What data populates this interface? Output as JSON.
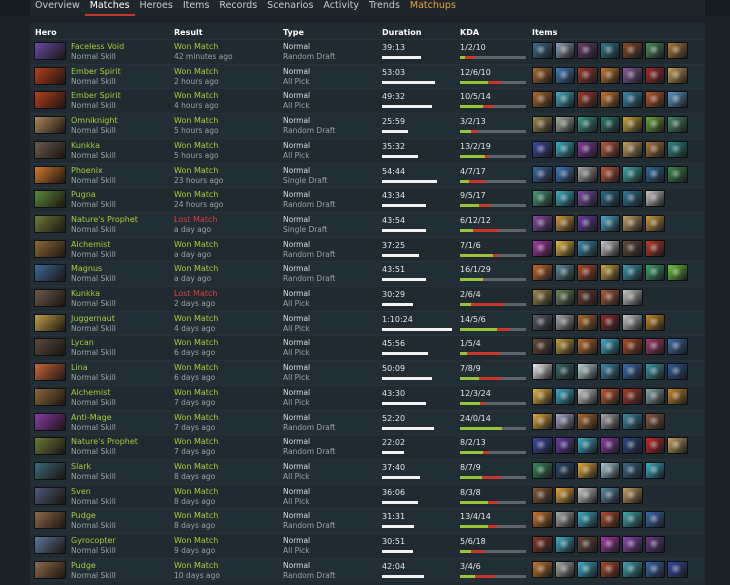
{
  "nav": {
    "tabs": [
      {
        "label": "Overview",
        "state": "normal"
      },
      {
        "label": "Matches",
        "state": "active"
      },
      {
        "label": "Heroes",
        "state": "normal"
      },
      {
        "label": "Items",
        "state": "normal"
      },
      {
        "label": "Records",
        "state": "normal"
      },
      {
        "label": "Scenarios",
        "state": "normal"
      },
      {
        "label": "Activity",
        "state": "normal"
      },
      {
        "label": "Trends",
        "state": "normal"
      },
      {
        "label": "Matchups",
        "state": "highlight"
      }
    ]
  },
  "table": {
    "headers": {
      "hero": "Hero",
      "result": "Result",
      "type": "Type",
      "duration": "Duration",
      "kda": "KDA",
      "items": "Items"
    },
    "rows": [
      {
        "hero": "Faceless Void",
        "skill": "Normal Skill",
        "result": "Won Match",
        "outcome": "win",
        "time": "42 minutes ago",
        "type": "Normal",
        "mode": "Random Draft",
        "duration": "39:13",
        "duration_min": 39.2,
        "kda": "1/2/10",
        "k": 1,
        "d": 2,
        "a": 10,
        "portrait": "#6a4aa8",
        "items": [
          "#3c6e8a",
          "#8fa6b8",
          "#6c3a70",
          "#2f7c8c",
          "#8a4a26",
          "#4a8f5a",
          "#b07a38"
        ]
      },
      {
        "hero": "Ember Spirit",
        "skill": "Normal Skill",
        "result": "Won Match",
        "outcome": "win",
        "time": "2 hours ago",
        "type": "Normal",
        "mode": "All Pick",
        "duration": "53:03",
        "duration_min": 53.1,
        "kda": "12/6/10",
        "k": 12,
        "d": 6,
        "a": 10,
        "portrait": "#b5401e",
        "items": [
          "#b06a2a",
          "#3f7fc0",
          "#a03a28",
          "#c8782a",
          "#8a5a9a",
          "#a82a2a",
          "#c8a050"
        ]
      },
      {
        "hero": "Ember Spirit",
        "skill": "Normal Skill",
        "result": "Won Match",
        "outcome": "win",
        "time": "4 hours ago",
        "type": "Normal",
        "mode": "All Pick",
        "duration": "49:32",
        "duration_min": 49.5,
        "kda": "10/5/14",
        "k": 10,
        "d": 5,
        "a": 14,
        "portrait": "#b5401e",
        "items": [
          "#b06a2a",
          "#3fb0c8",
          "#a03a28",
          "#c8782a",
          "#3a8ab0",
          "#c05a2a",
          "#5a9ac8"
        ]
      },
      {
        "hero": "Omniknight",
        "skill": "Normal Skill",
        "result": "Won Match",
        "outcome": "win",
        "time": "5 hours ago",
        "type": "Normal",
        "mode": "Random Draft",
        "duration": "25:59",
        "duration_min": 26.0,
        "kda": "3/2/13",
        "k": 3,
        "d": 2,
        "a": 13,
        "portrait": "#a88858",
        "items": [
          "#a08a4a",
          "#a8b0a0",
          "#3a9a8a",
          "#2a7a6a",
          "#c8a83a",
          "#6aa83a",
          "#4a8a6a"
        ]
      },
      {
        "hero": "Kunkka",
        "skill": "Normal Skill",
        "result": "Won Match",
        "outcome": "win",
        "time": "5 hours ago",
        "type": "Normal",
        "mode": "All Pick",
        "duration": "35:32",
        "duration_min": 35.5,
        "kda": "13/2/19",
        "k": 13,
        "d": 2,
        "a": 19,
        "portrait": "#6a5a4a",
        "items": [
          "#3a4aa8",
          "#3ab0c8",
          "#8a3aa8",
          "#c05a3a",
          "#c8a060",
          "#b07a38",
          "#2a8a8a"
        ]
      },
      {
        "hero": "Phoenix",
        "skill": "Normal Skill",
        "result": "Won Match",
        "outcome": "win",
        "time": "23 hours ago",
        "type": "Normal",
        "mode": "Single Draft",
        "duration": "54:44",
        "duration_min": 54.7,
        "kda": "4/7/17",
        "k": 4,
        "d": 7,
        "a": 17,
        "portrait": "#d07a2a",
        "items": [
          "#3a6aa8",
          "#3a7ac0",
          "#a8a8a8",
          "#c05a3a",
          "#3aa8a8",
          "#2a6a9a",
          "#3a8a4a"
        ]
      },
      {
        "hero": "Pugna",
        "skill": "Normal Skill",
        "result": "Won Match",
        "outcome": "win",
        "time": "24 hours ago",
        "type": "Normal",
        "mode": "Random Draft",
        "duration": "43:34",
        "duration_min": 43.6,
        "kda": "9/5/17",
        "k": 9,
        "d": 5,
        "a": 17,
        "portrait": "#5a8a3a",
        "items": [
          "#4a9a7a",
          "#3ab0c8",
          "#7a4aa8",
          "#2a6a8a",
          "#2a7a9a",
          "#c8c8c8"
        ]
      },
      {
        "hero": "Nature's Prophet",
        "skill": "Normal Skill",
        "result": "Lost Match",
        "outcome": "loss",
        "time": "a day ago",
        "type": "Normal",
        "mode": "Single Draft",
        "duration": "43:54",
        "duration_min": 43.9,
        "kda": "6/12/12",
        "k": 6,
        "d": 12,
        "a": 12,
        "portrait": "#6a7a3a",
        "items": [
          "#8a4aa8",
          "#d09a3a",
          "#6a3aa8",
          "#4aa8c8",
          "#c8a060",
          "#c89a3a"
        ]
      },
      {
        "hero": "Alchemist",
        "skill": "Normal Skill",
        "result": "Won Match",
        "outcome": "win",
        "time": "a day ago",
        "type": "Normal",
        "mode": "Random Draft",
        "duration": "37:25",
        "duration_min": 37.4,
        "kda": "7/1/6",
        "k": 7,
        "d": 1,
        "a": 6,
        "portrait": "#8a6a3a",
        "items": [
          "#a83aa8",
          "#e8b83a",
          "#3a8ab0",
          "#c8c8c8",
          "#6a4a3a",
          "#c03a2a"
        ]
      },
      {
        "hero": "Magnus",
        "skill": "Normal Skill",
        "result": "Won Match",
        "outcome": "win",
        "time": "a day ago",
        "type": "Normal",
        "mode": "Random Draft",
        "duration": "43:51",
        "duration_min": 43.9,
        "kda": "16/1/29",
        "k": 16,
        "d": 1,
        "a": 29,
        "portrait": "#3a6a9a",
        "items": [
          "#c86a2a",
          "#5a8a9a",
          "#b04a2a",
          "#c8a83a",
          "#3a9ab0",
          "#3aa86a",
          "#6ac83a"
        ]
      },
      {
        "hero": "Kunkka",
        "skill": "Normal Skill",
        "result": "Lost Match",
        "outcome": "loss",
        "time": "2 days ago",
        "type": "Normal",
        "mode": "All Pick",
        "duration": "30:29",
        "duration_min": 30.5,
        "kda": "2/6/4",
        "k": 2,
        "d": 6,
        "a": 4,
        "portrait": "#6a5a4a",
        "items": [
          "#a08a4a",
          "#6a8a5a",
          "#6a3a2a",
          "#b05a3a",
          "#c8c8c8"
        ]
      },
      {
        "hero": "Juggernaut",
        "skill": "Normal Skill",
        "result": "Won Match",
        "outcome": "win",
        "time": "4 days ago",
        "type": "Normal",
        "mode": "All Pick",
        "duration": "1:10:24",
        "duration_min": 70.4,
        "kda": "14/5/6",
        "k": 14,
        "d": 5,
        "a": 6,
        "portrait": "#c0a04a",
        "items": [
          "#5a5a6a",
          "#a8a8a8",
          "#b06a2a",
          "#8a2a2a",
          "#c8c8c8",
          "#c8882a"
        ]
      },
      {
        "hero": "Lycan",
        "skill": "Normal Skill",
        "result": "Won Match",
        "outcome": "win",
        "time": "6 days ago",
        "type": "Normal",
        "mode": "All Pick",
        "duration": "45:56",
        "duration_min": 45.9,
        "kda": "1/5/4",
        "k": 1,
        "d": 5,
        "a": 4,
        "portrait": "#5a4a3a",
        "items": [
          "#6a4a3a",
          "#c8a03a",
          "#c06a2a",
          "#3ab0c8",
          "#b04a2a",
          "#a83a6a",
          "#3a6ab0"
        ]
      },
      {
        "hero": "Lina",
        "skill": "Normal Skill",
        "result": "Won Match",
        "outcome": "win",
        "time": "6 days ago",
        "type": "Normal",
        "mode": "All Pick",
        "duration": "50:09",
        "duration_min": 50.2,
        "kda": "7/8/9",
        "k": 7,
        "d": 8,
        "a": 9,
        "portrait": "#c86a3a",
        "items": [
          "#f0f0f0",
          "#3a6a6a",
          "#b8d8d8",
          "#3a8ab0",
          "#3a6ab0",
          "#3a9aa8",
          "#2a5a9a"
        ]
      },
      {
        "hero": "Alchemist",
        "skill": "Normal Skill",
        "result": "Won Match",
        "outcome": "win",
        "time": "7 days ago",
        "type": "Normal",
        "mode": "All Pick",
        "duration": "43:30",
        "duration_min": 43.5,
        "kda": "12/3/24",
        "k": 12,
        "d": 3,
        "a": 24,
        "portrait": "#8a6a3a",
        "items": [
          "#e8b83a",
          "#3ab0c8",
          "#c8c8c8",
          "#c05a2a",
          "#a83a2a",
          "#8aa8a8",
          "#c8882a"
        ]
      },
      {
        "hero": "Anti-Mage",
        "skill": "Normal Skill",
        "result": "Won Match",
        "outcome": "win",
        "time": "7 days ago",
        "type": "Normal",
        "mode": "Random Draft",
        "duration": "52:20",
        "duration_min": 52.3,
        "kda": "24/0/14",
        "k": 24,
        "d": 0,
        "a": 14,
        "portrait": "#8a3aa8",
        "items": [
          "#e8a83a",
          "#a8a8c8",
          "#b06a2a",
          "#a8a8a8",
          "#3a8aa8",
          "#8a5a3a"
        ]
      },
      {
        "hero": "Nature's Prophet",
        "skill": "Normal Skill",
        "result": "Won Match",
        "outcome": "win",
        "time": "7 days ago",
        "type": "Normal",
        "mode": "Random Draft",
        "duration": "22:02",
        "duration_min": 22.0,
        "kda": "8/2/13",
        "k": 8,
        "d": 2,
        "a": 13,
        "portrait": "#6a7a3a",
        "items": [
          "#3a4aa8",
          "#6a3aa8",
          "#3ab0c8",
          "#8a3aa8",
          "#2a4a8a",
          "#c82a2a",
          "#c8a060"
        ]
      },
      {
        "hero": "Slark",
        "skill": "Normal Skill",
        "result": "Won Match",
        "outcome": "win",
        "time": "8 days ago",
        "type": "Normal",
        "mode": "All Pick",
        "duration": "37:40",
        "duration_min": 37.7,
        "kda": "8/7/9",
        "k": 8,
        "d": 7,
        "a": 9,
        "portrait": "#3a6a7a",
        "items": [
          "#3a8a5a",
          "#2a4a6a",
          "#e8a83a",
          "#a8c8d8",
          "#3a6a8a",
          "#3ab0c8"
        ]
      },
      {
        "hero": "Sven",
        "skill": "Normal Skill",
        "result": "Won Match",
        "outcome": "win",
        "time": "8 days ago",
        "type": "Normal",
        "mode": "All Pick",
        "duration": "36:06",
        "duration_min": 36.1,
        "kda": "8/3/8",
        "k": 8,
        "d": 3,
        "a": 8,
        "portrait": "#4a5a7a",
        "items": [
          "#8a5a3a",
          "#e8a83a",
          "#c8c8c8",
          "#5a8aa8",
          "#c8a060"
        ]
      },
      {
        "hero": "Pudge",
        "skill": "Normal Skill",
        "result": "Won Match",
        "outcome": "win",
        "time": "8 days ago",
        "type": "Normal",
        "mode": "Random Draft",
        "duration": "31:31",
        "duration_min": 31.5,
        "kda": "13/4/14",
        "k": 13,
        "d": 4,
        "a": 14,
        "portrait": "#8a6a4a",
        "items": [
          "#c8782a",
          "#a8a8a8",
          "#3ab0c8",
          "#b04a2a",
          "#3aa8b0",
          "#3a6ab0"
        ]
      },
      {
        "hero": "Gyrocopter",
        "skill": "Normal Skill",
        "result": "Won Match",
        "outcome": "win",
        "time": "9 days ago",
        "type": "Normal",
        "mode": "All Pick",
        "duration": "30:51",
        "duration_min": 30.9,
        "kda": "5/6/18",
        "k": 5,
        "d": 6,
        "a": 18,
        "portrait": "#5a7a9a",
        "items": [
          "#8a3a2a",
          "#3ab0c8",
          "#6a4a3a",
          "#a83aa8",
          "#8a4ab0",
          "#6a3a8a"
        ]
      },
      {
        "hero": "Pudge",
        "skill": "Normal Skill",
        "result": "Won Match",
        "outcome": "win",
        "time": "10 days ago",
        "type": "Normal",
        "mode": "Random Draft",
        "duration": "42:04",
        "duration_min": 42.1,
        "kda": "3/4/6",
        "k": 3,
        "d": 4,
        "a": 6,
        "portrait": "#8a6a4a",
        "items": [
          "#c8782a",
          "#a8a8a8",
          "#3ab0c8",
          "#b04a2a",
          "#3aa8b0",
          "#3a6ab0",
          "#3a4aa8"
        ]
      }
    ]
  }
}
